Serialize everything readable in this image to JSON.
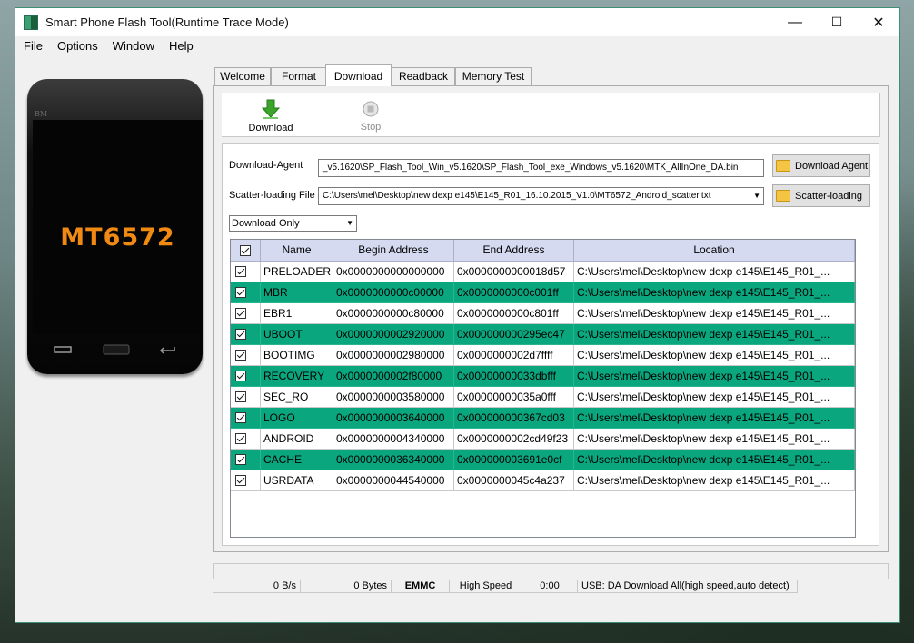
{
  "window": {
    "title": "Smart Phone Flash Tool(Runtime Trace Mode)",
    "controls": {
      "minimize": "—",
      "maximize": "☐",
      "close": "✕"
    }
  },
  "menu": [
    "File",
    "Options",
    "Window",
    "Help"
  ],
  "phone": {
    "brand": "BM",
    "model": "MT6572"
  },
  "tabs": [
    {
      "label": "Welcome",
      "active": false
    },
    {
      "label": "Format",
      "active": false
    },
    {
      "label": "Download",
      "active": true
    },
    {
      "label": "Readback",
      "active": false
    },
    {
      "label": "Memory Test",
      "active": false
    }
  ],
  "toolbar": {
    "download_label": "Download",
    "stop_label": "Stop",
    "download_icon_color": "#3aa52a"
  },
  "download_agent": {
    "label": "Download-Agent",
    "value": "_v5.1620\\SP_Flash_Tool_Win_v5.1620\\SP_Flash_Tool_exe_Windows_v5.1620\\MTK_AllInOne_DA.bin",
    "button": "Download Agent"
  },
  "scatter": {
    "label": "Scatter-loading File",
    "value": "C:\\Users\\mel\\Desktop\\new dexp e145\\E145_R01_16.10.2015_V1.0\\MT6572_Android_scatter.txt",
    "button": "Scatter-loading"
  },
  "mode_select": {
    "value": "Download Only"
  },
  "table": {
    "headers": [
      "Name",
      "Begin Address",
      "End Address",
      "Location"
    ],
    "highlight_color": "#0aa67e",
    "rows": [
      {
        "name": "PRELOADER",
        "begin": "0x0000000000000000",
        "end": "0x0000000000018d57",
        "location": "C:\\Users\\mel\\Desktop\\new dexp e145\\E145_R01_...",
        "highlight": false
      },
      {
        "name": "MBR",
        "begin": "0x0000000000c00000",
        "end": "0x0000000000c001ff",
        "location": "C:\\Users\\mel\\Desktop\\new dexp e145\\E145_R01_...",
        "highlight": true
      },
      {
        "name": "EBR1",
        "begin": "0x0000000000c80000",
        "end": "0x0000000000c801ff",
        "location": "C:\\Users\\mel\\Desktop\\new dexp e145\\E145_R01_...",
        "highlight": false
      },
      {
        "name": "UBOOT",
        "begin": "0x0000000002920000",
        "end": "0x000000000295ec47",
        "location": "C:\\Users\\mel\\Desktop\\new dexp e145\\E145_R01_...",
        "highlight": true
      },
      {
        "name": "BOOTIMG",
        "begin": "0x0000000002980000",
        "end": "0x0000000002d7ffff",
        "location": "C:\\Users\\mel\\Desktop\\new dexp e145\\E145_R01_...",
        "highlight": false
      },
      {
        "name": "RECOVERY",
        "begin": "0x0000000002f80000",
        "end": "0x00000000033dbfff",
        "location": "C:\\Users\\mel\\Desktop\\new dexp e145\\E145_R01_...",
        "highlight": true
      },
      {
        "name": "SEC_RO",
        "begin": "0x0000000003580000",
        "end": "0x00000000035a0fff",
        "location": "C:\\Users\\mel\\Desktop\\new dexp e145\\E145_R01_...",
        "highlight": false
      },
      {
        "name": "LOGO",
        "begin": "0x0000000003640000",
        "end": "0x000000000367cd03",
        "location": "C:\\Users\\mel\\Desktop\\new dexp e145\\E145_R01_...",
        "highlight": true
      },
      {
        "name": "ANDROID",
        "begin": "0x0000000004340000",
        "end": "0x0000000002cd49f23",
        "location": "C:\\Users\\mel\\Desktop\\new dexp e145\\E145_R01_...",
        "highlight": false
      },
      {
        "name": "CACHE",
        "begin": "0x0000000036340000",
        "end": "0x000000003691e0cf",
        "location": "C:\\Users\\mel\\Desktop\\new dexp e145\\E145_R01_...",
        "highlight": true
      },
      {
        "name": "USRDATA",
        "begin": "0x0000000044540000",
        "end": "0x0000000045c4a237",
        "location": "C:\\Users\\mel\\Desktop\\new dexp e145\\E145_R01_...",
        "highlight": false
      }
    ]
  },
  "status": {
    "speed": "0 B/s",
    "bytes": "0 Bytes",
    "storage": "EMMC",
    "speed_mode": "High Speed",
    "time": "0:00",
    "usb": "USB: DA Download All(high speed,auto detect)"
  }
}
